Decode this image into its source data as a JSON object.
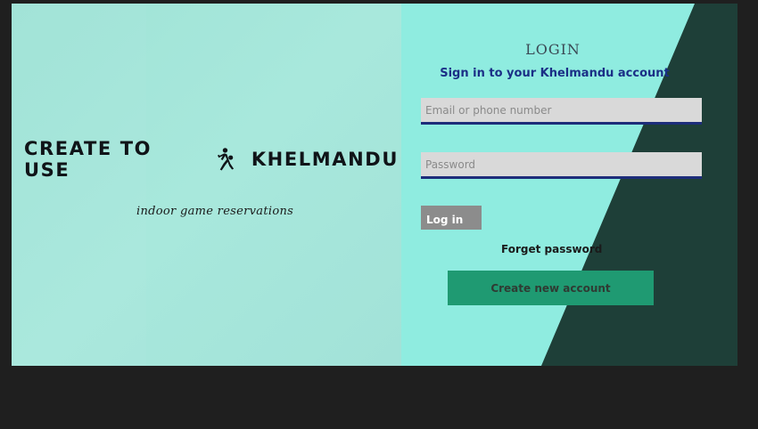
{
  "brand": {
    "left_text": "CREATE TO USE",
    "right_text": "KHELMANDU",
    "tagline": "indoor game reservations",
    "logo_icon": "basketball-player-icon"
  },
  "login": {
    "title": "LOGIN",
    "subtitle": "Sign in to your Khelmandu account",
    "email_placeholder": "Email or phone number",
    "password_placeholder": "Password",
    "login_label": "Log in",
    "forget_label": "Forget password",
    "create_label": "Create new account"
  },
  "colors": {
    "left_bg": "#a5e6da",
    "right_bg": "#8fece0",
    "dark_wedge": "#1e3f38",
    "field_bg": "#d9d9d9",
    "field_underline": "#1d2d7a",
    "subtitle": "#1b2f86",
    "login_button": "#8c8c8c",
    "create_button": "#1f9a72",
    "page_bg": "#1f1f1f"
  }
}
